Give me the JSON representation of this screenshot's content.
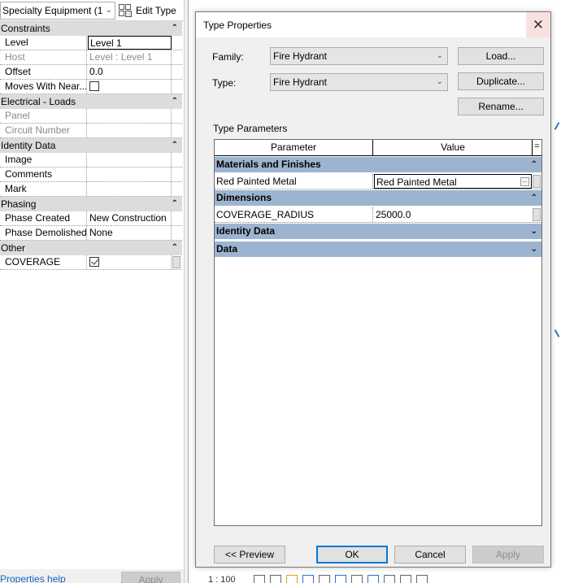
{
  "properties_palette": {
    "type_selector": "Specialty Equipment (1",
    "edit_type_label": "Edit Type",
    "groups": [
      {
        "name": "Constraints",
        "rows": [
          {
            "key": "Level",
            "value": "Level 1",
            "state": "selected"
          },
          {
            "key": "Host",
            "value": "Level : Level 1",
            "state": "disabled"
          },
          {
            "key": "Offset",
            "value": "0.0",
            "state": "normal"
          },
          {
            "key": "Moves With Near...",
            "value": "",
            "checkbox": false,
            "state": "normal"
          }
        ]
      },
      {
        "name": "Electrical - Loads",
        "rows": [
          {
            "key": "Panel",
            "value": "",
            "state": "disabled"
          },
          {
            "key": "Circuit Number",
            "value": "",
            "state": "disabled"
          }
        ]
      },
      {
        "name": "Identity Data",
        "rows": [
          {
            "key": "Image",
            "value": "",
            "state": "normal"
          },
          {
            "key": "Comments",
            "value": "",
            "state": "normal"
          },
          {
            "key": "Mark",
            "value": "",
            "state": "normal"
          }
        ]
      },
      {
        "name": "Phasing",
        "rows": [
          {
            "key": "Phase Created",
            "value": "New Construction",
            "state": "normal"
          },
          {
            "key": "Phase Demolished",
            "value": "None",
            "state": "normal"
          }
        ]
      },
      {
        "name": "Other",
        "rows": [
          {
            "key": "COVERAGE",
            "value": "",
            "checkbox": true,
            "state": "normal"
          }
        ]
      }
    ],
    "help_link": "Properties help",
    "apply_label": "Apply"
  },
  "dialog": {
    "title": "Type Properties",
    "family_label": "Family:",
    "family_value": "Fire Hydrant",
    "type_label": "Type:",
    "type_value": "Fire Hydrant",
    "load_label": "Load...",
    "duplicate_label": "Duplicate...",
    "rename_label": "Rename...",
    "type_parameters_label": "Type Parameters",
    "columns": {
      "parameter": "Parameter",
      "value": "Value",
      "eq": "="
    },
    "groups": [
      {
        "name": "Materials and Finishes",
        "expanded": true,
        "rows": [
          {
            "key": "Red Painted Metal",
            "value": "Red Painted Metal",
            "editing": true
          }
        ]
      },
      {
        "name": "Dimensions",
        "expanded": true,
        "rows": [
          {
            "key": "COVERAGE_RADIUS",
            "value": "25000.0",
            "editing": false
          }
        ]
      },
      {
        "name": "Identity Data",
        "expanded": false,
        "rows": []
      },
      {
        "name": "Data",
        "expanded": false,
        "rows": []
      }
    ],
    "preview_label": "<< Preview",
    "ok_label": "OK",
    "cancel_label": "Cancel",
    "apply_label": "Apply"
  },
  "status_bar": {
    "scale": "1 : 100"
  },
  "colors": {
    "group_header_blue": "#9db4d0",
    "palette_group_gray": "#dcdcdc",
    "link_blue": "#1a66c2",
    "ok_focus_border": "#0078d7",
    "close_hover": "#f9e1e1"
  }
}
